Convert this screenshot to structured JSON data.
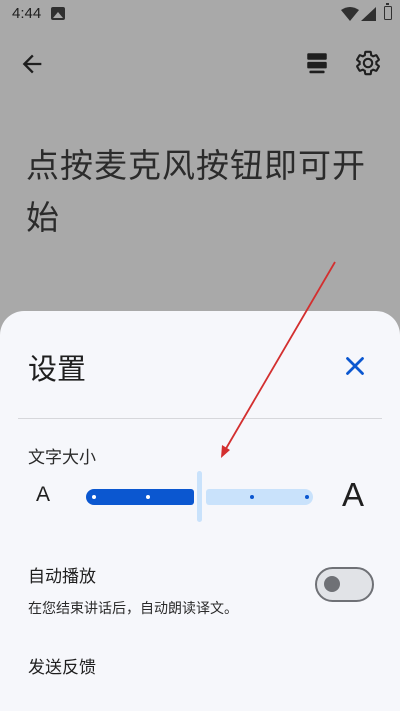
{
  "status_bar": {
    "time": "4:44",
    "icons": [
      "gallery-icon",
      "wifi-icon",
      "signal-icon",
      "battery-icon"
    ]
  },
  "app_bar": {
    "icons": [
      "back-icon",
      "transcript-icon",
      "settings-icon"
    ]
  },
  "main": {
    "prompt": "点按麦克风按钮即可开始"
  },
  "settings_sheet": {
    "title": "设置",
    "close_icon": "close-icon",
    "text_size": {
      "label": "文字大小",
      "small_glyph": "A",
      "large_glyph": "A",
      "steps": 5,
      "selected_step": 3
    },
    "auto_play": {
      "label": "自动播放",
      "description": "在您结束讲话后，自动朗读译文。",
      "enabled": false
    },
    "feedback": {
      "label": "发送反馈"
    }
  },
  "colors": {
    "accent": "#0b57d0",
    "accent_light": "#c9e2fb",
    "scrim": "#a9a9a9",
    "sheet_background": "#f6f7fb",
    "annotation_arrow": "#d32f2f"
  }
}
